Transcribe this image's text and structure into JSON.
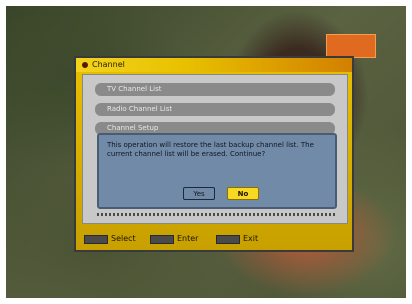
{
  "logo": {
    "text": ""
  },
  "menu": {
    "title": "Channel",
    "items": [
      {
        "label": "TV Channel List"
      },
      {
        "label": "Radio Channel List"
      },
      {
        "label": "Channel Setup"
      }
    ]
  },
  "dialog": {
    "message": "This operation will restore the last backup channel list. The current channel list will be erased. Continue?",
    "yes_label": "Yes",
    "no_label": "No",
    "selected": "No"
  },
  "footer": {
    "select_label": "Select",
    "enter_label": "Enter",
    "exit_label": "Exit"
  },
  "colors": {
    "menu_frame": "#e8c000",
    "dialog_bg": "#708aa8",
    "selected_button": "#f8d820"
  }
}
